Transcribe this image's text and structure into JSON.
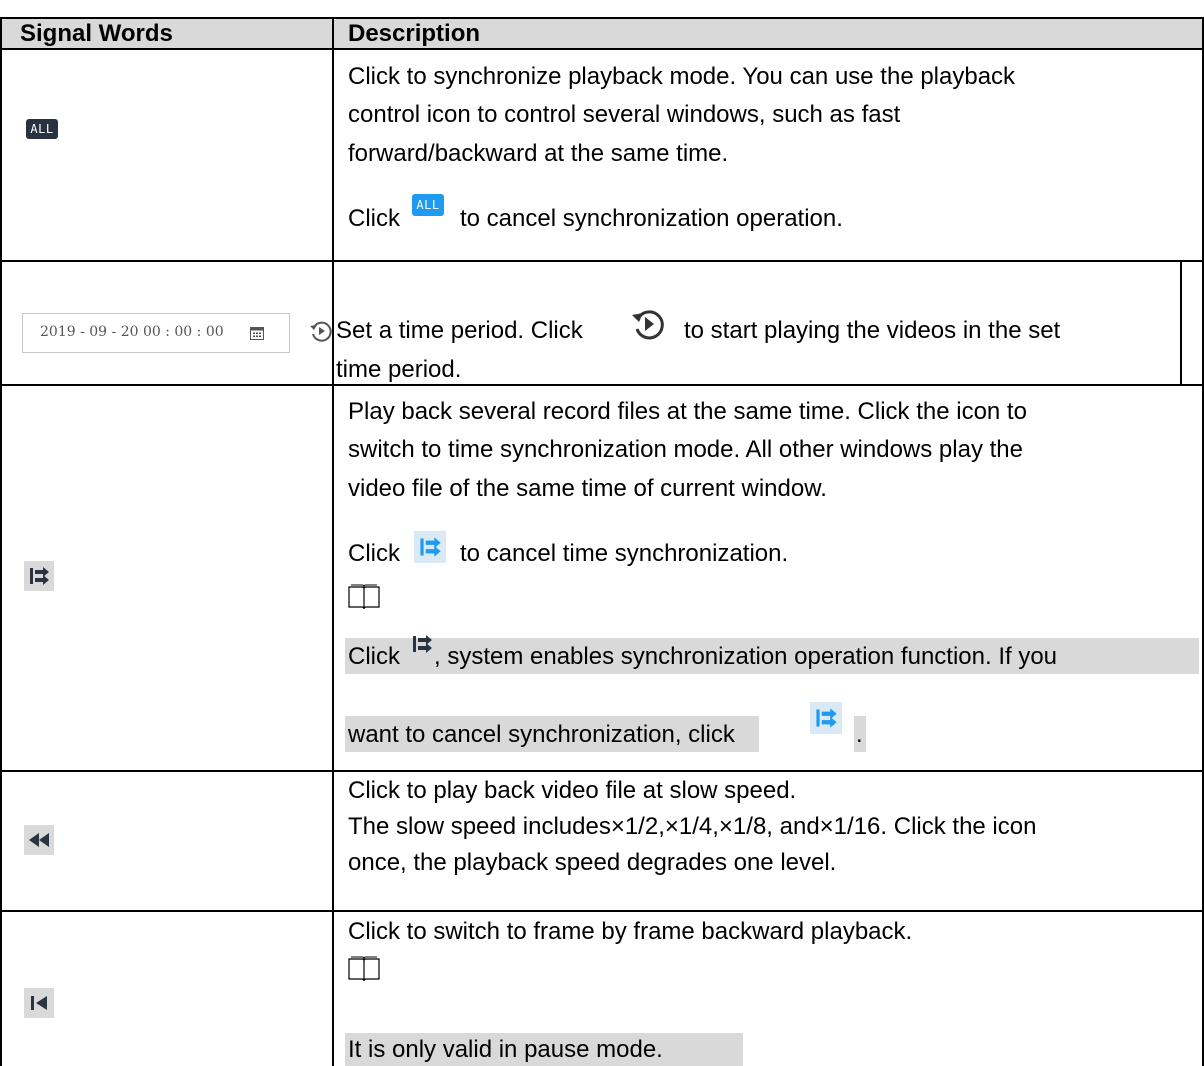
{
  "header": {
    "col1": "Signal Words",
    "col2": "Description"
  },
  "rows": {
    "all": {
      "icon": "ALL",
      "line1": "Click to synchronize playback mode. You can use the playback",
      "line2": "control icon to control several windows, such as fast",
      "line3": "forward/backward at the same time.",
      "cancel_pre": "Click",
      "cancel_icon": "ALL",
      "cancel_post": "to cancel synchronization operation."
    },
    "time": {
      "date_value": "2019 - 09 - 20  00 : 00 : 00",
      "line1_pre": "Set a time period. Click",
      "line1_post": "to start playing the videos in the set",
      "line2": "time period."
    },
    "sync": {
      "line1": "Play back several record files at the same time. Click the icon to",
      "line2": "switch to time synchronization mode. All other windows play the",
      "line3": "video file of the same time of current window.",
      "cancel_pre": "Click",
      "cancel_post": "to cancel time synchronization.",
      "note1_pre": "Click",
      "note1_post": ", system enables synchronization operation function. If you",
      "note2_pre": "want to cancel synchronization, click",
      "note2_post": "."
    },
    "slow": {
      "line1": "Click to play back video file at slow speed.",
      "line2": "The slow speed includes×1/2,×1/4,×1/8, and×1/16. Click the icon",
      "line3": "once, the playback speed degrades one level."
    },
    "frame": {
      "line1": "Click to switch to frame by frame backward playback.",
      "note": "It is only valid in pause mode."
    }
  },
  "colors": {
    "header_bg": "#d9d9d9",
    "accent_blue": "#1e9bf0",
    "icon_dark": "#283240"
  },
  "icons": [
    "all-sync-icon",
    "calendar-icon",
    "replay-icon",
    "time-sync-icon",
    "note-book-icon",
    "slow-play-icon",
    "frame-back-icon"
  ]
}
